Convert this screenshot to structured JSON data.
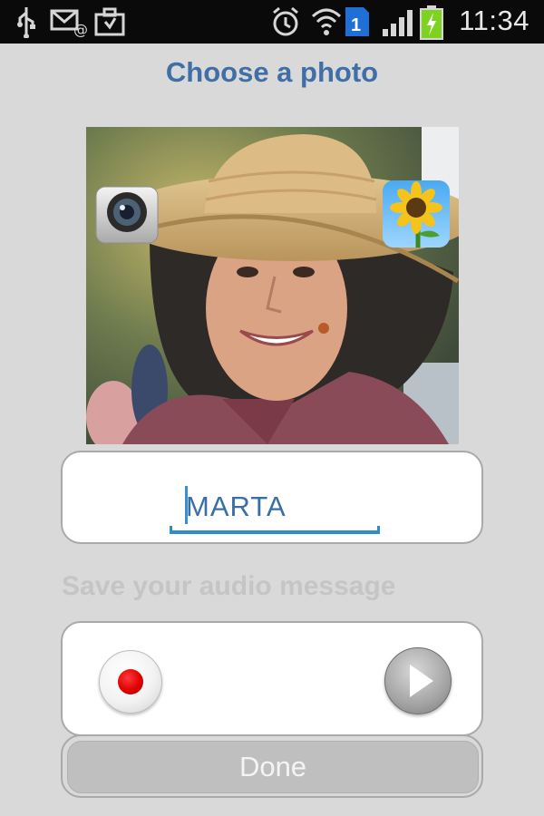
{
  "status_bar": {
    "time": "11:34",
    "sim_badge": "1",
    "icons": [
      "usb-icon",
      "email-icon",
      "briefcase-icon",
      "alarm-icon",
      "wifi-icon",
      "sim-icon",
      "signal-icon",
      "battery-icon"
    ]
  },
  "header": {
    "title": "Choose a photo"
  },
  "photo": {
    "camera_button": "camera-icon",
    "gallery_button": "sunflower-gallery-icon"
  },
  "name_field": {
    "value": "MARTA"
  },
  "audio": {
    "label": "Save your audio message",
    "record_button": "record-icon",
    "play_button": "play-icon"
  },
  "footer": {
    "done_label": "Done"
  },
  "colors": {
    "accent": "#3f6fa6",
    "input_underline": "#2f8ec7",
    "record_red": "#e00000",
    "background": "#d9d9d9"
  }
}
